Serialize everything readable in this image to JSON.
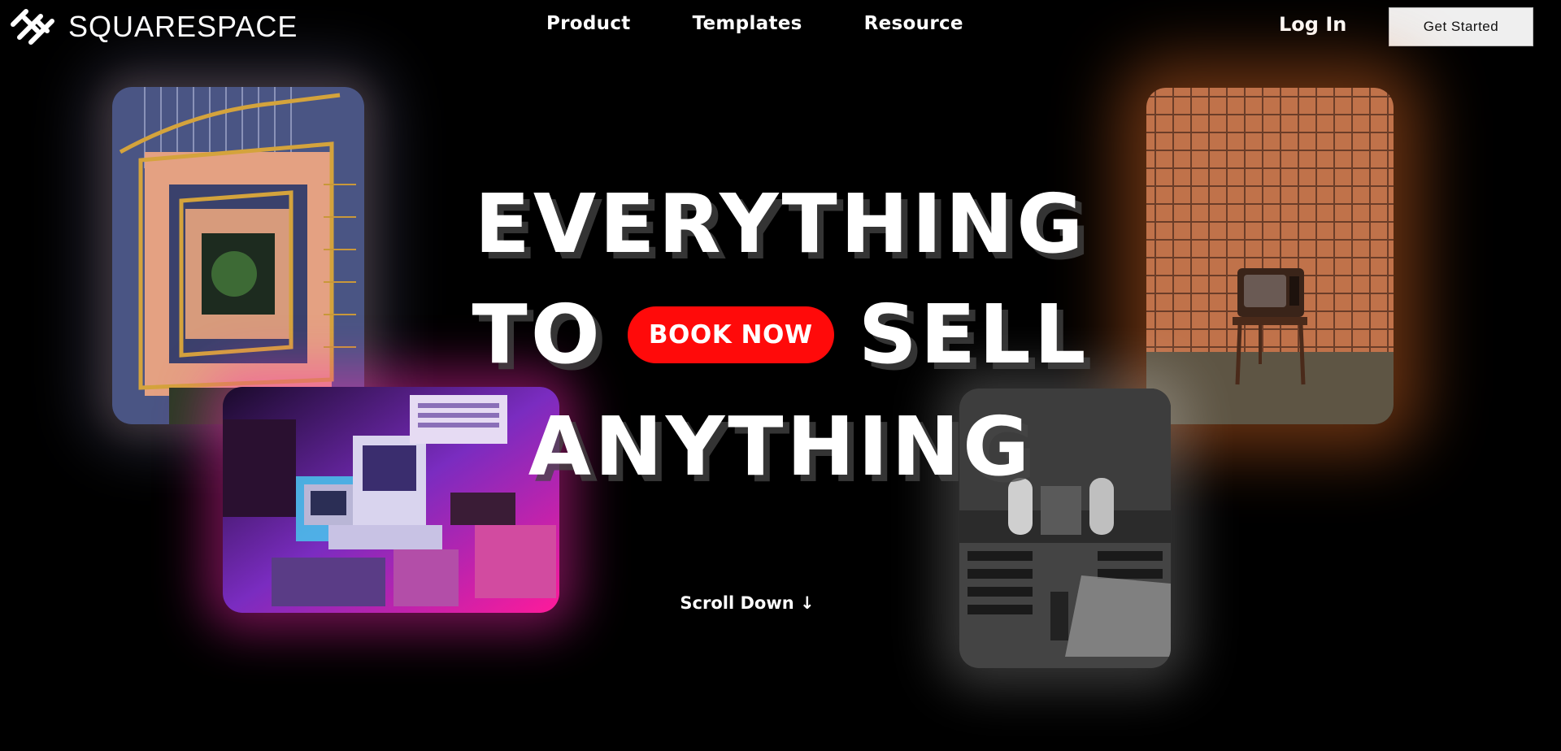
{
  "brand": {
    "name": "SQUARESPACE",
    "logo_icon": "squarespace-logo-icon"
  },
  "nav": {
    "items": [
      {
        "label": "Product"
      },
      {
        "label": "Templates"
      },
      {
        "label": "Resource"
      }
    ],
    "login_label": "Log In",
    "cta_label": "Get Started"
  },
  "hero": {
    "line1": "EVERYTHING",
    "line2_left": "TO",
    "line2_button": "BOOK NOW",
    "line2_right": "SELL",
    "line3": "ANYTHING",
    "scroll_label": "Scroll Down ↓"
  },
  "colors": {
    "background": "#000000",
    "accent_red": "#ff0a0a",
    "text": "#ffffff",
    "cta_background": "#efefef"
  },
  "images": [
    {
      "name": "staircase-photo"
    },
    {
      "name": "retro-computers-photo"
    },
    {
      "name": "vintage-tv-photo"
    },
    {
      "name": "church-interior-photo"
    }
  ]
}
